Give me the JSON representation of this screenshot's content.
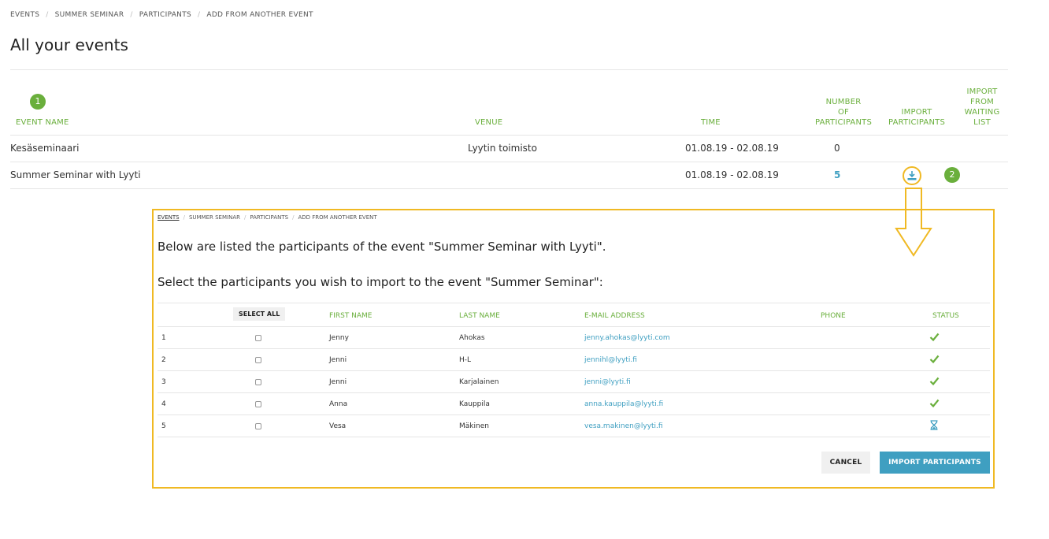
{
  "breadcrumb": [
    "EVENTS",
    "SUMMER SEMINAR",
    "PARTICIPANTS",
    "ADD FROM ANOTHER EVENT"
  ],
  "page_title": "All your events",
  "events_table": {
    "headers": {
      "event_name": "EVENT NAME",
      "venue": "VENUE",
      "time": "TIME",
      "participants_l1": "NUMBER",
      "participants_l2": "OF",
      "participants_l3": "PARTICIPANTS",
      "import_l1": "IMPORT",
      "import_l2": "PARTICIPANTS",
      "waiting_l1": "IMPORT",
      "waiting_l2": "FROM",
      "waiting_l3": "WAITING",
      "waiting_l4": "LIST"
    },
    "rows": [
      {
        "name": "Kesäseminaari",
        "venue": "Lyytin toimisto",
        "time": "01.08.19 - 02.08.19",
        "count": "0"
      },
      {
        "name": "Summer Seminar with Lyyti",
        "venue": "",
        "time": "01.08.19 - 02.08.19",
        "count": "5"
      }
    ]
  },
  "step_badges": [
    "1",
    "2"
  ],
  "import_panel": {
    "breadcrumb": [
      "EVENTS",
      "SUMMER SEMINAR",
      "PARTICIPANTS",
      "ADD FROM ANOTHER EVENT"
    ],
    "line1": "Below are listed the participants of the event \"Summer Seminar with Lyyti\".",
    "line2": "Select the participants you wish to import to the event \"Summer Seminar\":",
    "select_all": "SELECT ALL",
    "headers": {
      "first_name": "FIRST NAME",
      "last_name": "LAST NAME",
      "email": "E-MAIL ADDRESS",
      "phone": "PHONE",
      "status": "STATUS"
    },
    "rows": [
      {
        "n": "1",
        "first": "Jenny",
        "last": "Ahokas",
        "email": "jenny.ahokas@lyyti.com",
        "status": "check-icon"
      },
      {
        "n": "2",
        "first": "Jenni",
        "last": "H-L",
        "email": "jennihl@lyyti.fi",
        "status": "check-icon"
      },
      {
        "n": "3",
        "first": "Jenni",
        "last": "Karjalainen",
        "email": "jenni@lyyti.fi",
        "status": "check-icon"
      },
      {
        "n": "4",
        "first": "Anna",
        "last": "Kauppila",
        "email": "anna.kauppila@lyyti.fi",
        "status": "check-icon"
      },
      {
        "n": "5",
        "first": "Vesa",
        "last": "Mäkinen",
        "email": "vesa.makinen@lyyti.fi",
        "status": "hourglass-icon"
      }
    ],
    "cancel_label": "CANCEL",
    "import_label": "IMPORT PARTICIPANTS"
  },
  "colors": {
    "green": "#6aaf3c",
    "blue": "#3f9fc1",
    "highlight": "#f0b923"
  }
}
